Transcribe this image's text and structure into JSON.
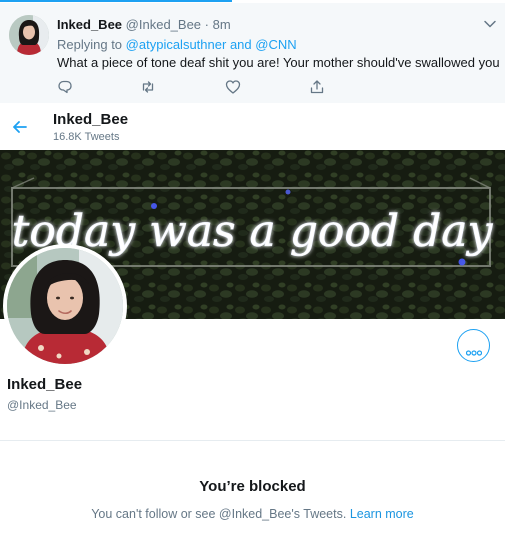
{
  "load_progress": 0.46,
  "tweet": {
    "name": "Inked_Bee",
    "handle": "@Inked_Bee",
    "separator": "·",
    "time": "8m",
    "replying_prefix": "Replying to",
    "mention_1": "@atypicalsuthner",
    "joiner": "and",
    "mention_2": "@CNN",
    "text": "What a piece of tone deaf shit you are! Your mother should've swallowed you",
    "actions": {
      "reply_icon": "reply-icon",
      "retweet_icon": "retweet-icon",
      "like_icon": "heart-icon",
      "share_icon": "share-icon"
    }
  },
  "profile": {
    "header_name": "Inked_Bee",
    "tweet_count": "16.8K Tweets",
    "banner_text": "today was a good day",
    "display_name": "Inked_Bee",
    "handle": "@Inked_Bee",
    "more_icon": "more-icon"
  },
  "blocked": {
    "title": "You’re blocked",
    "message": "You can't follow or see @Inked_Bee's Tweets.",
    "link": "Learn more"
  },
  "colors": {
    "accent": "#1da1f2",
    "text": "#14171a",
    "secondary": "#657786",
    "tweet_bg": "#f5f8fa"
  }
}
